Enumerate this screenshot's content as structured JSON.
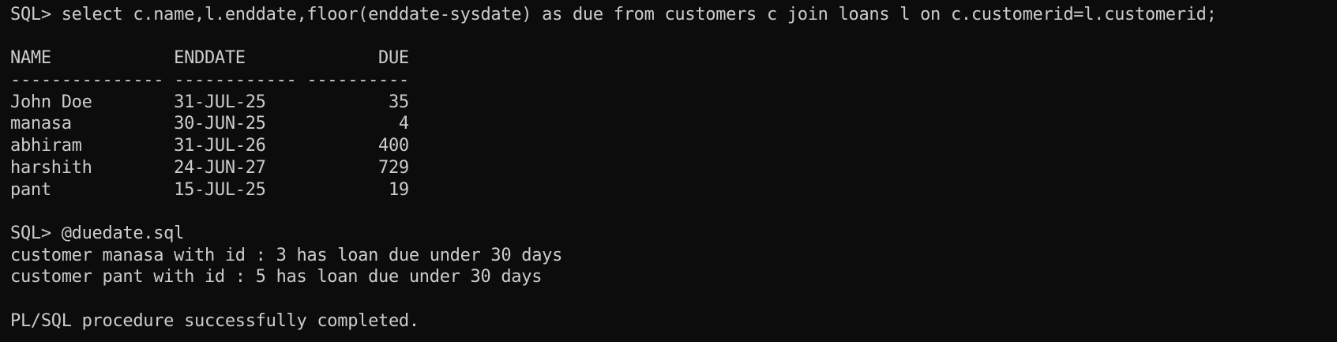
{
  "terminal": {
    "prompt": "SQL> ",
    "lines": [
      "SQL> select c.name,l.enddate,floor(enddate-sysdate) as due from customers c join loans l on c.customerid=l.customerid;",
      "",
      "NAME            ENDDATE             DUE",
      "--------------- ------------ ----------",
      "John Doe        31-JUL-25            35",
      "manasa          30-JUN-25             4",
      "abhiram         31-JUL-26           400",
      "harshith        24-JUN-27           729",
      "pant            15-JUL-25            19",
      "",
      "SQL> @duedate.sql",
      "customer manasa with id : 3 has loan due under 30 days",
      "customer pant with id : 5 has loan due under 30 days",
      "",
      "PL/SQL procedure successfully completed."
    ]
  },
  "query_result": {
    "columns": [
      "NAME",
      "ENDDATE",
      "DUE"
    ],
    "rows": [
      [
        "John Doe",
        "31-JUL-25",
        "35"
      ],
      [
        "manasa",
        "30-JUN-25",
        "4"
      ],
      [
        "abhiram",
        "31-JUL-26",
        "400"
      ],
      [
        "harshith",
        "24-JUN-27",
        "729"
      ],
      [
        "pant",
        "15-JUL-25",
        "19"
      ]
    ]
  },
  "colors": {
    "background": "#0c0c0c",
    "text": "#cccccc"
  }
}
